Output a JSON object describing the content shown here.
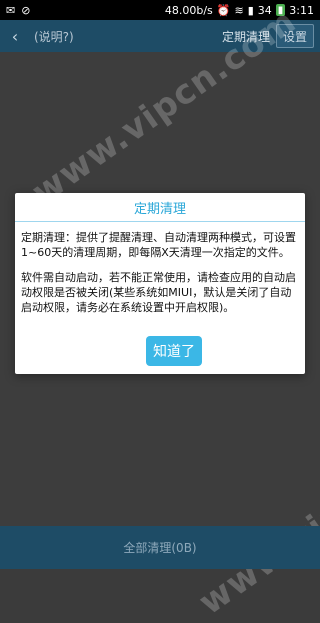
{
  "status_bar": {
    "left_icons": [
      "notification-icon",
      "sync-icon"
    ],
    "speed": "48.00b/s",
    "signal_text": "34",
    "time": "3:11"
  },
  "app_bar": {
    "title": "(说明?)",
    "right_title": "定期清理",
    "settings_label": "设置"
  },
  "dialog": {
    "title": "定期清理",
    "paragraph1": "定期清理：提供了提醒清理、自动清理两种模式，可设置1~60天的清理周期，即每隔X天清理一次指定的文件。",
    "paragraph2": "软件需自动启动，若不能正常使用，请检查应用的自动启动权限是否被关闭(某些系统如MIUI，默认是关闭了自动启动权限，请务必在系统设置中开启权限)。",
    "ok_label": "知道了"
  },
  "bottom": {
    "label": "全部清理(0B)"
  },
  "watermark": {
    "text": "www.vipcn.com"
  },
  "colors": {
    "appbar": "#1e4c66",
    "dialog_accent": "#2aa7d8",
    "button": "#3bb7e6"
  }
}
